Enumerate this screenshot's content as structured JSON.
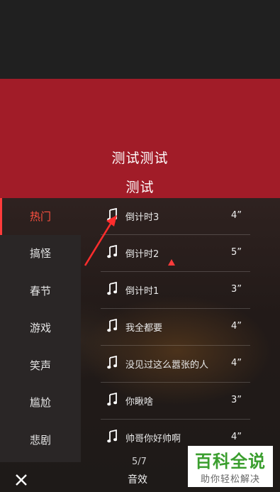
{
  "banner": {
    "line1": "测试测试",
    "line2": "测试"
  },
  "categories": [
    {
      "label": "热门",
      "active": true
    },
    {
      "label": "搞怪",
      "active": false
    },
    {
      "label": "春节",
      "active": false
    },
    {
      "label": "游戏",
      "active": false
    },
    {
      "label": "笑声",
      "active": false
    },
    {
      "label": "尴尬",
      "active": false
    },
    {
      "label": "悲剧",
      "active": false
    }
  ],
  "songs": [
    {
      "icon": "music-note-icon",
      "name": "倒计时3",
      "duration": "4”"
    },
    {
      "icon": "music-note-icon",
      "name": "倒计时2",
      "duration": "5”"
    },
    {
      "icon": "music-note-icon",
      "name": "倒计时1",
      "duration": "3”"
    },
    {
      "icon": "music-note-icon",
      "name": "我全都要",
      "duration": "4”"
    },
    {
      "icon": "music-note-icon",
      "name": "没见过这么嚣张的人",
      "duration": "4”"
    },
    {
      "icon": "music-note-icon",
      "name": "你瞅啥",
      "duration": "3”"
    },
    {
      "icon": "music-note-icon",
      "name": "帅哥你好帅啊",
      "duration": "4”"
    }
  ],
  "bottom": {
    "page": "5/7",
    "label": "音效",
    "close_icon": "close-icon"
  },
  "watermark": {
    "title": "百科全说",
    "subtitle": "助你轻松解决"
  },
  "colors": {
    "banner": "#a11c28",
    "accent": "#ff3b3b",
    "watermark_green": "#3a9e2e"
  }
}
